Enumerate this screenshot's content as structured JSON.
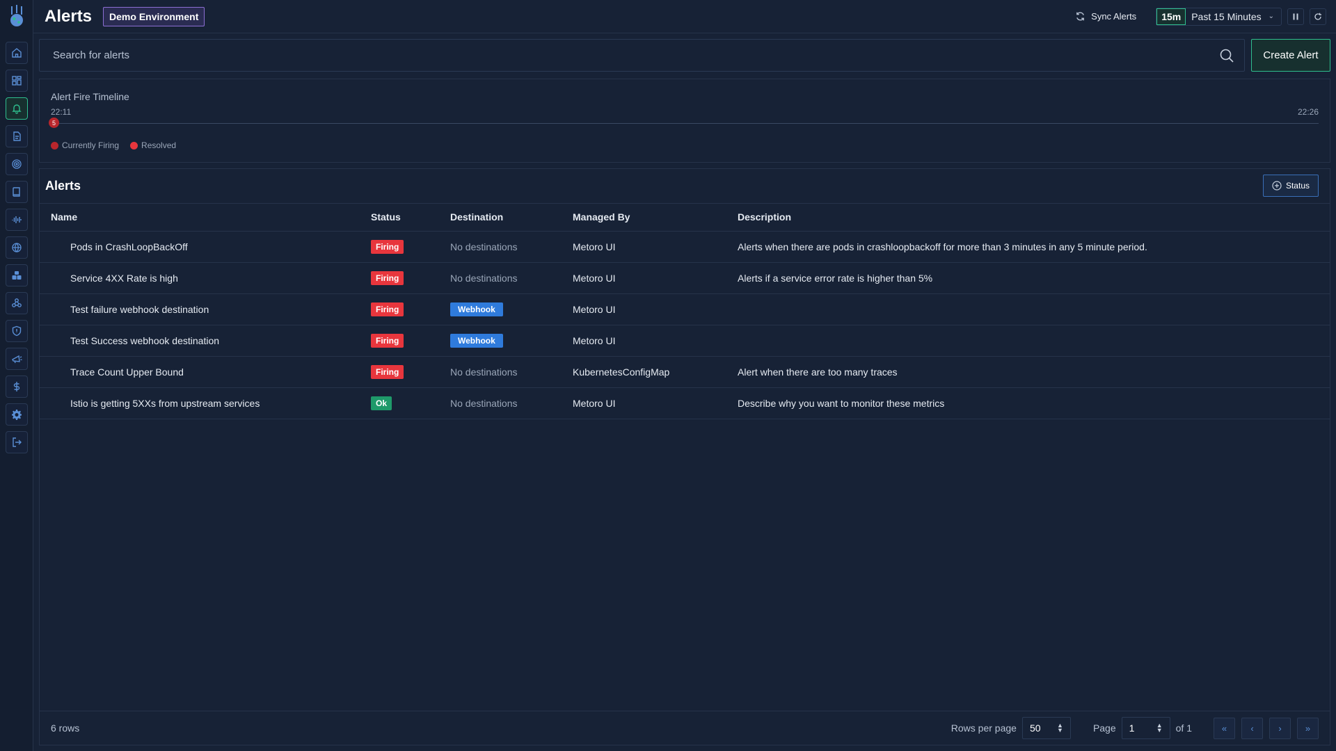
{
  "header": {
    "title": "Alerts",
    "environment": "Demo Environment",
    "sync_label": "Sync Alerts",
    "range_short": "15m",
    "range_label": "Past 15 Minutes"
  },
  "search": {
    "placeholder": "Search for alerts",
    "value": ""
  },
  "create_button": "Create Alert",
  "timeline": {
    "title": "Alert Fire Timeline",
    "start_time": "22:11",
    "end_time": "22:26",
    "marker_count": "5",
    "legend": [
      {
        "label": "Currently Firing",
        "color": "#b8262c"
      },
      {
        "label": "Resolved",
        "color": "#e8363d"
      }
    ]
  },
  "alerts_panel": {
    "title": "Alerts",
    "status_filter_label": "Status",
    "columns": [
      "Name",
      "Status",
      "Destination",
      "Managed By",
      "Description"
    ],
    "rows": [
      {
        "name": "Pods in CrashLoopBackOff",
        "status": "Firing",
        "destination": "No destinations",
        "managed_by": "Metoro UI",
        "description": "Alerts when there are pods in crashloopbackoff for more than 3 minutes in any 5 minute period."
      },
      {
        "name": "Service 4XX Rate is high",
        "status": "Firing",
        "destination": "No destinations",
        "managed_by": "Metoro UI",
        "description": "Alerts if a service error rate is higher than 5%"
      },
      {
        "name": "Test failure webhook destination",
        "status": "Firing",
        "destination": "Webhook",
        "managed_by": "Metoro UI",
        "description": ""
      },
      {
        "name": "Test Success webhook destination",
        "status": "Firing",
        "destination": "Webhook",
        "managed_by": "Metoro UI",
        "description": ""
      },
      {
        "name": "Trace Count Upper Bound",
        "status": "Firing",
        "destination": "No destinations",
        "managed_by": "KubernetesConfigMap",
        "description": "Alert when there are too many traces"
      },
      {
        "name": "Istio is getting 5XXs from upstream services",
        "status": "Ok",
        "destination": "No destinations",
        "managed_by": "Metoro UI",
        "description": "Describe why you want to monitor these metrics"
      }
    ]
  },
  "footer": {
    "row_count": "6 rows",
    "rows_per_page_label": "Rows per page",
    "rows_per_page_value": "50",
    "page_label": "Page",
    "page_value": "1",
    "page_total": "of 1"
  },
  "colors": {
    "background": "#172236",
    "accent_green": "#2fbf8f",
    "firing_red": "#e8363d",
    "ok_green": "#1f9a6a",
    "webhook_blue": "#2f7bdc",
    "env_purple": "#8c6fd4"
  },
  "sidebar_icons": [
    "home-icon",
    "dashboard-icon",
    "bell-icon",
    "logs-icon",
    "fingerprint-icon",
    "book-icon",
    "waveform-icon",
    "globe-icon",
    "cluster-icon",
    "nodes-icon",
    "shield-icon",
    "megaphone-icon",
    "dollar-icon",
    "gear-icon",
    "logout-icon"
  ]
}
